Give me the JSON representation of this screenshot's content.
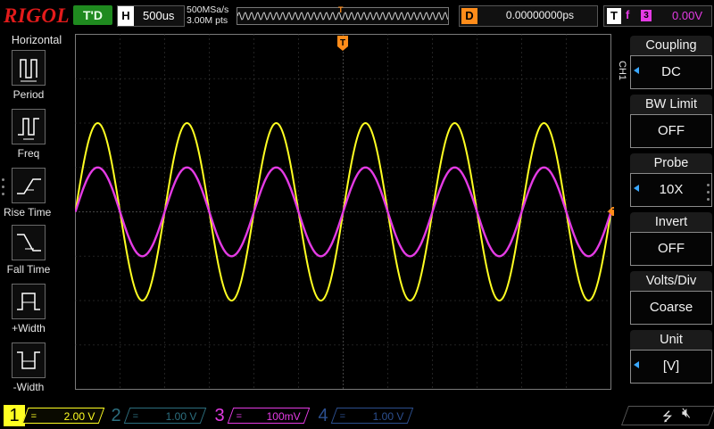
{
  "header": {
    "brand": "RIGOL",
    "trigger_status": "T'D",
    "horizontal_letter": "H",
    "timebase": "500us",
    "sample_rate": "500MSa/s",
    "memory_depth": "3.00M pts",
    "trigger_marker": "T",
    "delay_letter": "D",
    "delay_value": "0.00000000ps",
    "trigger_letter": "T",
    "trigger_edge": "f",
    "trigger_source": "3",
    "trigger_level": "0.00V"
  },
  "left_menu": {
    "title": "Horizontal",
    "items": [
      {
        "label": "Period",
        "icon": "period-icon"
      },
      {
        "label": "Freq",
        "icon": "freq-icon"
      },
      {
        "label": "Rise Time",
        "icon": "rise-time-icon"
      },
      {
        "label": "Fall Time",
        "icon": "fall-time-icon"
      },
      {
        "label": "+Width",
        "icon": "positive-width-icon"
      },
      {
        "label": "-Width",
        "icon": "negative-width-icon"
      }
    ]
  },
  "right_menu": {
    "channel_label": "CH1",
    "items": [
      {
        "title": "Coupling",
        "value": "DC",
        "has_arrow": true
      },
      {
        "title": "BW Limit",
        "value": "OFF",
        "has_arrow": false
      },
      {
        "title": "Probe",
        "value": "10X",
        "has_arrow": true
      },
      {
        "title": "Invert",
        "value": "OFF",
        "has_arrow": false
      },
      {
        "title": "Volts/Div",
        "value": "Coarse",
        "has_arrow": false
      },
      {
        "title": "Unit",
        "value": "[V]",
        "has_arrow": true
      }
    ]
  },
  "markers": {
    "ch1_ground": "1",
    "trigger_top": "T",
    "trigger_level_right": "T"
  },
  "waveforms": {
    "ch1": {
      "color": "#ffff22",
      "cycles": 6,
      "amplitude_div": 2.0
    },
    "ch3": {
      "color": "#e43be4",
      "cycles": 6,
      "amplitude_div": 1.0
    }
  },
  "channels": [
    {
      "num": "1",
      "coupling": "=",
      "scale": "2.00 V",
      "color": "#ffff22",
      "active": true
    },
    {
      "num": "2",
      "coupling": "=",
      "scale": "1.00 V",
      "color": "#2c6f7f",
      "active": false
    },
    {
      "num": "3",
      "coupling": "=",
      "scale": "100mV",
      "color": "#e43be4",
      "active": true
    },
    {
      "num": "4",
      "coupling": "=",
      "scale": "1.00 V",
      "color": "#2c4f8f",
      "active": false
    }
  ],
  "status": {
    "usb_icon": "usb-icon",
    "mute_icon": "mute-icon"
  }
}
